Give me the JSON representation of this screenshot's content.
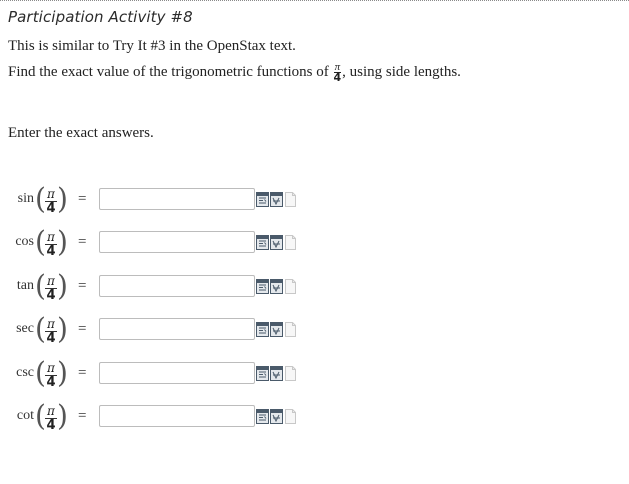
{
  "header": {
    "title": "Participation Activity #8"
  },
  "instructions": {
    "line1": "This is similar to Try It #3 in the OpenStax text.",
    "line2_prefix": "Find the exact value of the trigonometric functions of",
    "angle_num": "π",
    "angle_den": "4",
    "line2_suffix": ", using side lengths.",
    "line3": "Enter the exact answers."
  },
  "equals_sign": "=",
  "rows": [
    {
      "fn": "sin",
      "num": "π",
      "den": "4",
      "value": ""
    },
    {
      "fn": "cos",
      "num": "π",
      "den": "4",
      "value": ""
    },
    {
      "fn": "tan",
      "num": "π",
      "den": "4",
      "value": ""
    },
    {
      "fn": "sec",
      "num": "π",
      "den": "4",
      "value": ""
    },
    {
      "fn": "csc",
      "num": "π",
      "den": "4",
      "value": ""
    },
    {
      "fn": "cot",
      "num": "π",
      "den": "4",
      "value": ""
    }
  ],
  "tool_icons": [
    "math-editor-icon",
    "symbol-palette-icon",
    "help-document-icon"
  ],
  "colors": {
    "icon_frame": "#4a5a6a",
    "icon_fill": "#e4e8ec",
    "doc_icon": "#c8c8c8"
  }
}
